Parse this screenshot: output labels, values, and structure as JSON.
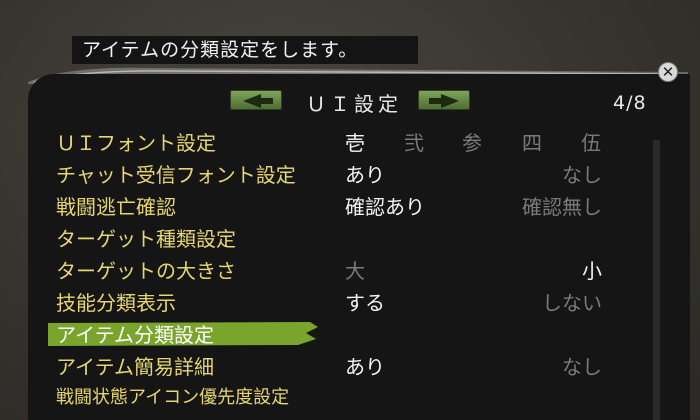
{
  "hint": "アイテムの分類設定をします。",
  "window": {
    "title": "ＵＩ設定",
    "page": "4/8",
    "close_symbol": "✕"
  },
  "settings": [
    {
      "label": "ＵＩフォント設定",
      "options": [
        "壱",
        "弐",
        "参",
        "四",
        "伍"
      ],
      "selected": 0
    },
    {
      "label": "チャット受信フォント設定",
      "options": [
        "あり",
        "なし"
      ],
      "selected": 0
    },
    {
      "label": "戦闘逃亡確認",
      "options": [
        "確認あり",
        "確認無し"
      ],
      "selected": 0
    },
    {
      "label": "ターゲット種類設定",
      "options": []
    },
    {
      "label": "ターゲットの大きさ",
      "options": [
        "大",
        "小"
      ],
      "selected": 1
    },
    {
      "label": "技能分類表示",
      "options": [
        "する",
        "しない"
      ],
      "selected": 0
    },
    {
      "label": "アイテム分類設定",
      "options": [],
      "highlighted": true
    },
    {
      "label": "アイテム簡易詳細",
      "options": [
        "あり",
        "なし"
      ],
      "selected": 0
    },
    {
      "label": "戦闘状態アイコン優先度設定",
      "options": []
    }
  ],
  "colors": {
    "label": "#e7d670",
    "selected_option": "#f4f4f4",
    "dim_option": "#7a7a7a",
    "highlight": "#7aa52c",
    "arrow_button": "#6a8d47"
  },
  "icons": {
    "prev": "left-arrow-icon",
    "next": "right-arrow-icon",
    "close": "close-icon"
  }
}
